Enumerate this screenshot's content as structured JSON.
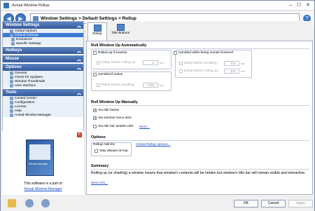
{
  "window": {
    "title": "Actual Window Rollup",
    "min_glyph": "–",
    "max_glyph": "☐",
    "close_glyph": "✕"
  },
  "nav": {
    "back_glyph": "◀",
    "forward_glyph": "▶",
    "help_glyph": "?",
    "breadcrumb": "Window Settings > Default Settings > Rollup"
  },
  "sidebar": {
    "chevron": "︽",
    "sections": {
      "window_settings": {
        "title": "Window Settings",
        "items": [
          "Global Options",
          "Default Settings",
          "Exclusions",
          "Specific Settings"
        ]
      },
      "hotkeys": {
        "title": "Hotkeys"
      },
      "mouse": {
        "title": "Mouse"
      },
      "options": {
        "title": "Options",
        "items": [
          "General",
          "Check for Updates",
          "Window Thumbnails",
          "User Interface"
        ]
      },
      "tools": {
        "title": "Tools",
        "items": [
          "Control Center",
          "Configuration",
          "License",
          "Help",
          "Actual Window Manager"
        ]
      }
    },
    "promo": {
      "close_glyph": "✕",
      "box_label": "Window Manager",
      "text": "This software is a part of",
      "link": "Actual Window Manager"
    }
  },
  "tabs": [
    {
      "label": "Rollup",
      "active": true
    },
    {
      "label": "Title Buttons",
      "active": false
    }
  ],
  "rollup_auto": {
    "title": "Roll Window Up Automatically",
    "rolled_if_inactive": "Rolled up if inactive",
    "delay_before_rolling_up": "Delay before rolling up",
    "delay_value_1": "1",
    "unrolled_if_active": "Unrolled if active",
    "delay_before_unrolling": "Delay before unrolling",
    "delay_value_2": "0.25",
    "unrolled_while_hovered": "Unrolled while being mouse-hovered",
    "delay_value_3": "0.5",
    "delay_value_4": "0.5",
    "unit": "sec"
  },
  "rollup_manual": {
    "title": "Roll Window Up Manually",
    "via_title_button": "Via title button",
    "via_window_menu": "Via window menu item",
    "via_double_click": "Via title bar double-click",
    "more": "More..."
  },
  "options_group": {
    "title": "Options",
    "addins_title": "Rollup Add-ins",
    "stay_on_top": "Stay always-on-top",
    "global_link": "Global Rollup options..."
  },
  "summary": {
    "title": "Summary",
    "text": "Rolling up (or shading) a window means that window's contents will be hidden but window's title bar will remain visible and interactive.",
    "more": "More info..."
  },
  "buttons": {
    "ok": "OK",
    "cancel": "Cancel",
    "apply": "Apply"
  },
  "check_glyph": "✓",
  "colors": {
    "header": "#33599a",
    "selection": "#3d7bd3",
    "link": "#1a4fbf"
  }
}
